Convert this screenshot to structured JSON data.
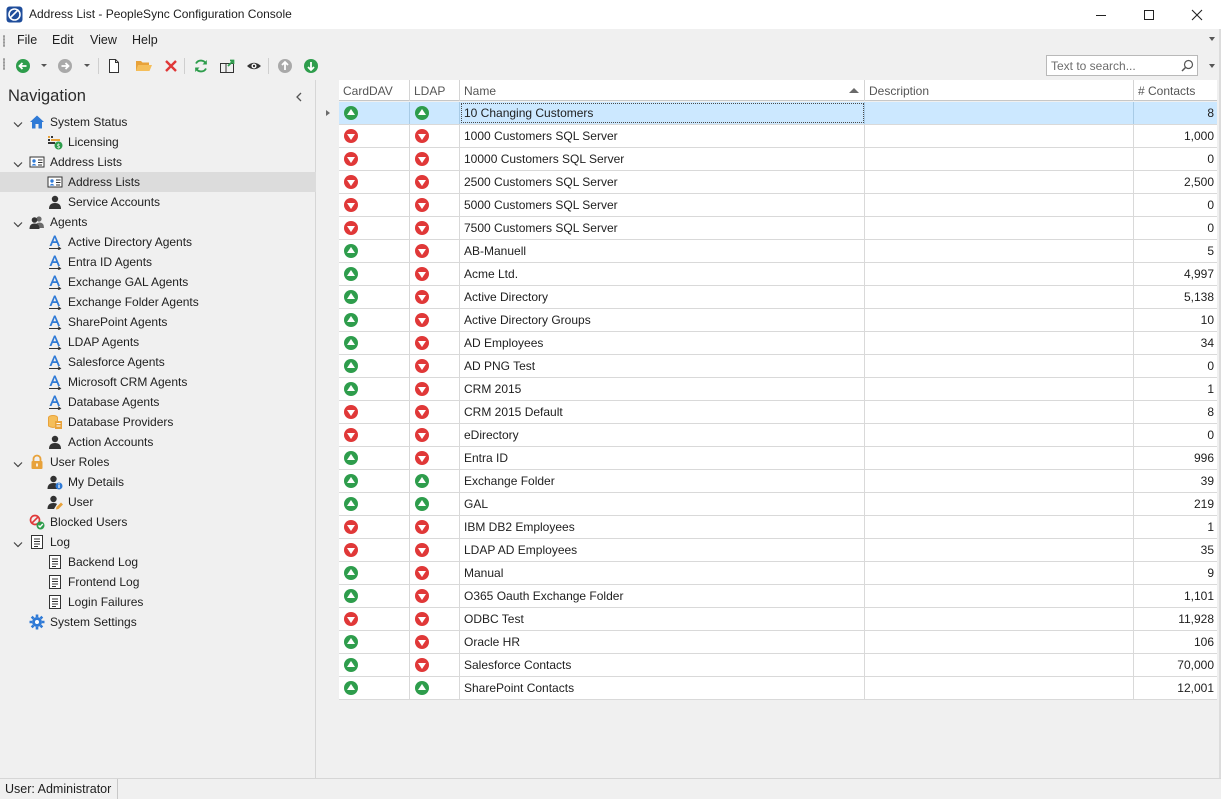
{
  "window": {
    "title": "Address List - PeopleSync Configuration Console",
    "minimize_icon": "minimize-icon",
    "maximize_icon": "maximize-icon",
    "close_icon": "close-icon"
  },
  "menu": {
    "items": [
      "File",
      "Edit",
      "View",
      "Help"
    ]
  },
  "toolbar": {
    "buttons": [
      "back-arrow-icon",
      "forward-arrow-icon",
      "new-document-icon",
      "open-folder-icon",
      "delete-icon",
      "refresh-icon",
      "export-icon",
      "preview-eye-icon",
      "move-up-icon",
      "move-down-icon"
    ],
    "search_placeholder": "Text to search...",
    "colors": {
      "green": "#2e9d4c",
      "red": "#e03838",
      "orange": "#e8a23a",
      "gray": "#9a9a9a"
    }
  },
  "nav": {
    "title": "Navigation",
    "items": [
      {
        "label": "System Status",
        "icon": "home-icon",
        "level": 0,
        "expanded": true
      },
      {
        "label": "Licensing",
        "icon": "license-icon",
        "level": 1
      },
      {
        "label": "Address Lists",
        "icon": "address-card-icon",
        "level": 0,
        "expanded": true
      },
      {
        "label": "Address Lists",
        "icon": "address-card-icon",
        "level": 1,
        "selected": true
      },
      {
        "label": "Service Accounts",
        "icon": "user-icon",
        "level": 1
      },
      {
        "label": "Agents",
        "icon": "users-icon",
        "level": 0,
        "expanded": true
      },
      {
        "label": "Active Directory Agents",
        "icon": "agent-icon",
        "level": 1
      },
      {
        "label": "Entra ID Agents",
        "icon": "agent-icon",
        "level": 1
      },
      {
        "label": "Exchange GAL Agents",
        "icon": "agent-icon",
        "level": 1
      },
      {
        "label": "Exchange Folder Agents",
        "icon": "agent-icon",
        "level": 1
      },
      {
        "label": "SharePoint Agents",
        "icon": "agent-icon",
        "level": 1
      },
      {
        "label": "LDAP Agents",
        "icon": "agent-icon",
        "level": 1
      },
      {
        "label": "Salesforce Agents",
        "icon": "agent-icon",
        "level": 1
      },
      {
        "label": "Microsoft CRM Agents",
        "icon": "agent-icon",
        "level": 1
      },
      {
        "label": "Database Agents",
        "icon": "agent-icon",
        "level": 1
      },
      {
        "label": "Database Providers",
        "icon": "database-icon",
        "level": 1
      },
      {
        "label": "Action Accounts",
        "icon": "user-icon",
        "level": 1
      },
      {
        "label": "User Roles",
        "icon": "lock-icon",
        "level": 0,
        "expanded": true
      },
      {
        "label": "My Details",
        "icon": "user-info-icon",
        "level": 1
      },
      {
        "label": "User",
        "icon": "user-edit-icon",
        "level": 1
      },
      {
        "label": "Blocked Users",
        "icon": "blocked-users-icon",
        "level": 0
      },
      {
        "label": "Log",
        "icon": "log-icon",
        "level": 0,
        "expanded": true
      },
      {
        "label": "Backend Log",
        "icon": "log-icon",
        "level": 1
      },
      {
        "label": "Frontend Log",
        "icon": "log-icon",
        "level": 1
      },
      {
        "label": "Login Failures",
        "icon": "log-icon",
        "level": 1
      },
      {
        "label": "System Settings",
        "icon": "gear-icon",
        "level": 0
      }
    ]
  },
  "grid": {
    "columns": [
      "CardDAV",
      "LDAP",
      "Name",
      "Description",
      "# Contacts"
    ],
    "sort_column": "Name",
    "sort_direction": "ascending",
    "rows": [
      {
        "carddav": "up",
        "ldap": "up",
        "name": "10 Changing Customers",
        "description": "",
        "contacts": "8",
        "selected": true
      },
      {
        "carddav": "down",
        "ldap": "down",
        "name": "1000 Customers SQL Server",
        "description": "",
        "contacts": "1,000"
      },
      {
        "carddav": "down",
        "ldap": "down",
        "name": "10000 Customers SQL Server",
        "description": "",
        "contacts": "0"
      },
      {
        "carddav": "down",
        "ldap": "down",
        "name": "2500 Customers SQL Server",
        "description": "",
        "contacts": "2,500"
      },
      {
        "carddav": "down",
        "ldap": "down",
        "name": "5000 Customers SQL Server",
        "description": "",
        "contacts": "0"
      },
      {
        "carddav": "down",
        "ldap": "down",
        "name": "7500 Customers SQL Server",
        "description": "",
        "contacts": "0"
      },
      {
        "carddav": "up",
        "ldap": "down",
        "name": "AB-Manuell",
        "description": "",
        "contacts": "5"
      },
      {
        "carddav": "up",
        "ldap": "down",
        "name": "Acme Ltd.",
        "description": "",
        "contacts": "4,997"
      },
      {
        "carddav": "up",
        "ldap": "down",
        "name": "Active Directory",
        "description": "",
        "contacts": "5,138"
      },
      {
        "carddav": "up",
        "ldap": "down",
        "name": "Active Directory Groups",
        "description": "",
        "contacts": "10"
      },
      {
        "carddav": "up",
        "ldap": "down",
        "name": "AD Employees",
        "description": "",
        "contacts": "34"
      },
      {
        "carddav": "up",
        "ldap": "down",
        "name": "AD PNG Test",
        "description": "",
        "contacts": "0"
      },
      {
        "carddav": "up",
        "ldap": "down",
        "name": "CRM 2015",
        "description": "",
        "contacts": "1"
      },
      {
        "carddav": "down",
        "ldap": "down",
        "name": "CRM 2015 Default",
        "description": "",
        "contacts": "8"
      },
      {
        "carddav": "down",
        "ldap": "down",
        "name": "eDirectory",
        "description": "",
        "contacts": "0"
      },
      {
        "carddav": "up",
        "ldap": "down",
        "name": "Entra ID",
        "description": "",
        "contacts": "996"
      },
      {
        "carddav": "up",
        "ldap": "up",
        "name": "Exchange Folder",
        "description": "",
        "contacts": "39"
      },
      {
        "carddav": "up",
        "ldap": "up",
        "name": "GAL",
        "description": "",
        "contacts": "219"
      },
      {
        "carddav": "down",
        "ldap": "down",
        "name": "IBM DB2 Employees",
        "description": "",
        "contacts": "1"
      },
      {
        "carddav": "down",
        "ldap": "down",
        "name": "LDAP AD Employees",
        "description": "",
        "contacts": "35"
      },
      {
        "carddav": "up",
        "ldap": "down",
        "name": "Manual",
        "description": "",
        "contacts": "9"
      },
      {
        "carddav": "up",
        "ldap": "down",
        "name": "O365 Oauth Exchange Folder",
        "description": "",
        "contacts": "1,101"
      },
      {
        "carddav": "down",
        "ldap": "down",
        "name": "ODBC Test",
        "description": "",
        "contacts": "11,928"
      },
      {
        "carddav": "up",
        "ldap": "down",
        "name": "Oracle HR",
        "description": "",
        "contacts": "106"
      },
      {
        "carddav": "up",
        "ldap": "down",
        "name": "Salesforce Contacts",
        "description": "",
        "contacts": "70,000"
      },
      {
        "carddav": "up",
        "ldap": "up",
        "name": "SharePoint Contacts",
        "description": "",
        "contacts": "12,001"
      }
    ]
  },
  "status_bar": {
    "user_text": "User: Administrator"
  }
}
